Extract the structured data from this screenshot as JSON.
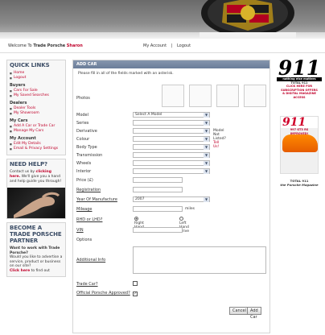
{
  "header": {
    "welcome_prefix": "Welcome To",
    "brand": "Trade Porsche",
    "username": "Sharon",
    "my_account": "My Account",
    "separator": "|",
    "logout": "Logout"
  },
  "sidebar": {
    "quick_links_title": "QUICK LINKS",
    "quick": [
      "Home",
      "Logout"
    ],
    "buyers_title": "Buyers",
    "buyers": [
      "Cars For Sale",
      "My Saved Searches"
    ],
    "dealers_title": "Dealers",
    "dealers": [
      "Dealer Tools",
      "My Showroom"
    ],
    "mycars_title": "My Cars",
    "mycars": [
      "Add A Car or Trade Car",
      "Manage My Cars"
    ],
    "account_title": "My Account",
    "account": [
      "Edit My Details",
      "Email & Privacy Settings"
    ],
    "help_title": "NEED HELP?",
    "help_text_1": "Contact us by",
    "help_link": "clicking here.",
    "help_text_2": "We'll give you a hand and help guide you through!",
    "partner_title": "BECOME A TRADE PORSCHE PARTNER",
    "partner_q": "Want to work with Trade Porsche?",
    "partner_text": "Would you like to advertise a service, product or business on our site?",
    "partner_link": "Click here",
    "partner_tail": "to find out"
  },
  "form": {
    "title": "ADD CAR",
    "intro": "Please fill in all of the fields marked with an asterisk.",
    "photos_label": "Photos",
    "model_label": "Model",
    "model_value": "Select A Model",
    "series_label": "Series",
    "derivative_label": "Derivative",
    "model_not_listed": "Model Not Listed?",
    "tell_us": "Tell Us!",
    "colour_label": "Colour",
    "body_label": "Body Type",
    "transmission_label": "Transmission",
    "wheels_label": "Wheels",
    "interior_label": "Interior",
    "price_label": "Price (£)",
    "registration_label": "Registration",
    "year_label": "Year Of Manufacture",
    "year_value": "2007",
    "mileage_label": "Mileage",
    "miles_unit": "miles",
    "rhd_label": "RHD or LHD?",
    "rhd_option": "Right Hand Drive",
    "lhd_option": "Left Hand Drive",
    "vin_label": "VIN",
    "options_label": "Options",
    "additional_label": "Additional Info",
    "trade_label": "Trade Car?",
    "official_label": "Official Porsche Approved?",
    "official_check": "✓",
    "cancel": "Cancel",
    "add_car": "Add Car"
  },
  "ad": {
    "masthead": "911",
    "tagline": "nothing else matters",
    "line1": "TOTAL 911",
    "line2": "CLICK HERE FOR",
    "line3": "SUBSCRIPTION OFFERS",
    "line4": "& DIGITAL MAGAZINE",
    "line5": "ACCESS",
    "mag_title": "911",
    "mag_strap": "997 GT3 RS IMPROVED!",
    "caption1": "TOTAL 911",
    "caption2": "the Porsche Magazine"
  },
  "colors": {
    "accent": "#c0002a",
    "header_bar": "#6a7d99"
  }
}
